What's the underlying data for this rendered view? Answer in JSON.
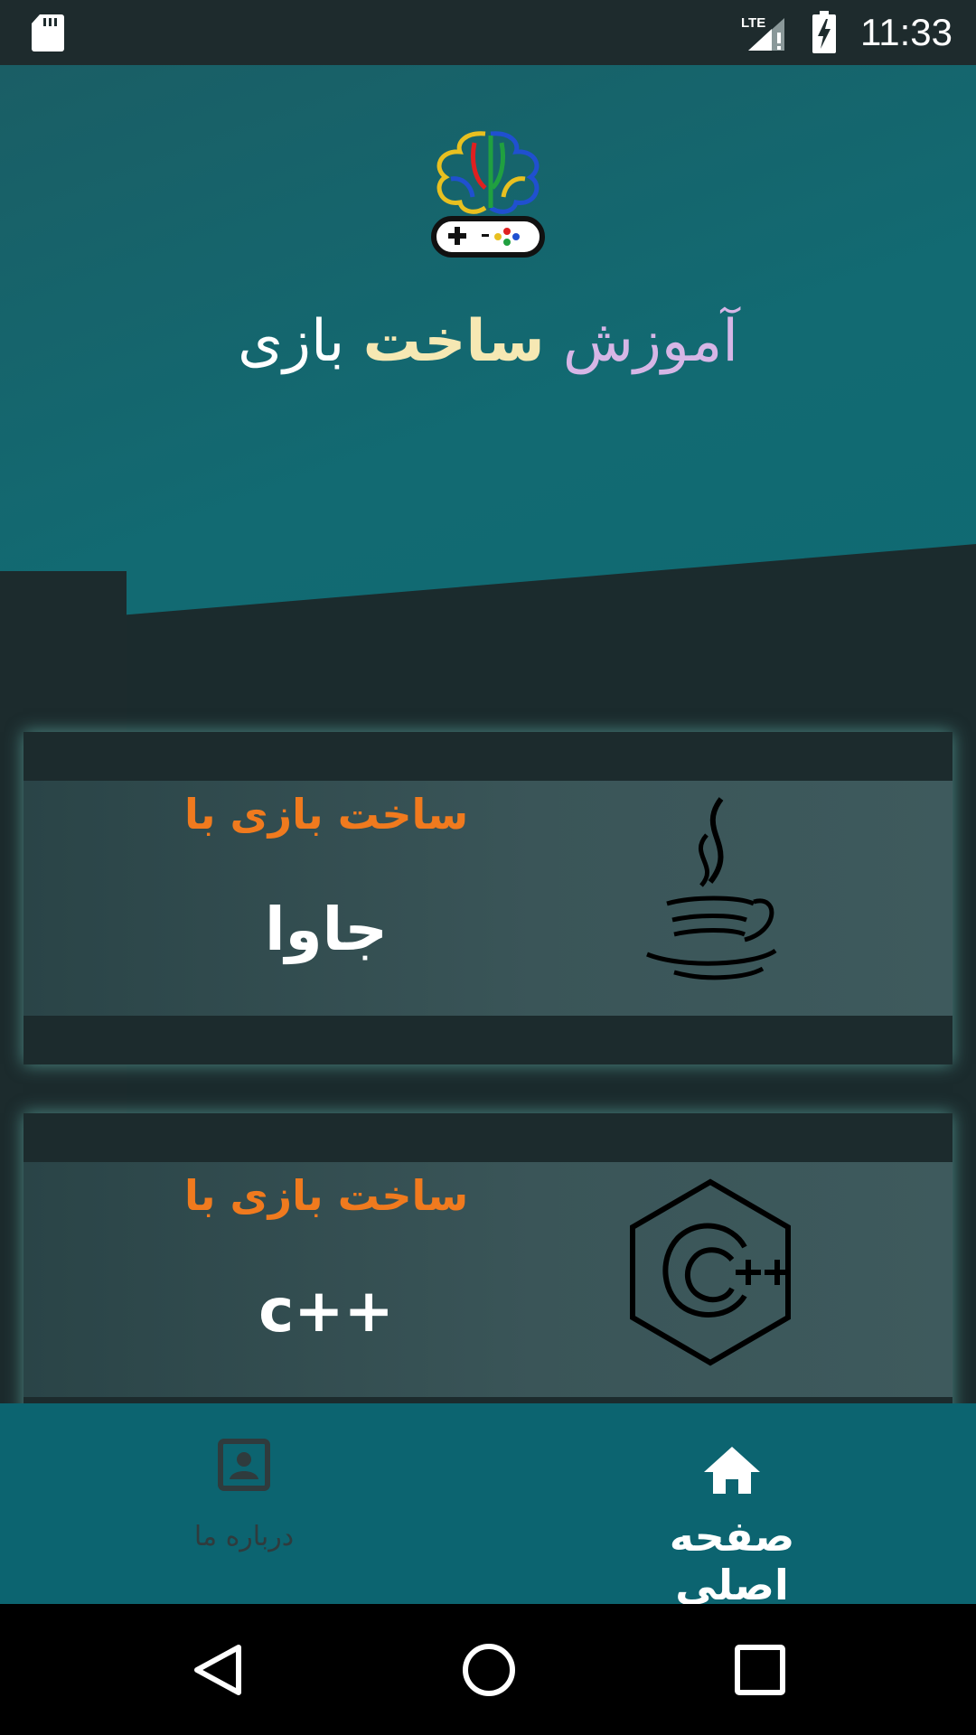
{
  "status_bar": {
    "time": "11:33",
    "network": "LTE",
    "icons": [
      "sd-card-icon",
      "signal-icon",
      "battery-charging-icon"
    ]
  },
  "header": {
    "title_part1": "آموزش",
    "title_part2": "ساخت",
    "title_part3": "بازی",
    "logo_icon": "brain-gamepad-logo"
  },
  "cards": [
    {
      "heading": "ساخت بازی با",
      "name": "جاوا",
      "icon": "java-icon"
    },
    {
      "heading": "ساخت بازی با",
      "name": "c++",
      "icon": "cpp-icon"
    }
  ],
  "bottom_nav": {
    "about_label": "درباره ما",
    "home_label": "صفحه اصلی",
    "about_icon": "contact-card-icon",
    "home_icon": "home-icon"
  },
  "colors": {
    "hero": "#126a72",
    "dark": "#1c2b2d",
    "accent": "#f07a1e",
    "nav": "#0c6470"
  }
}
